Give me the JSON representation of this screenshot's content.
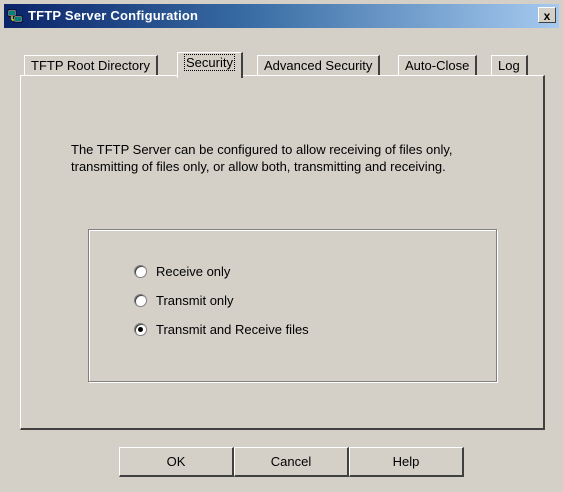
{
  "window": {
    "title": "TFTP Server Configuration",
    "close_label": "x"
  },
  "tabs": [
    {
      "label": "TFTP Root Directory",
      "active": false
    },
    {
      "label": "Security",
      "active": true
    },
    {
      "label": "Advanced Security",
      "active": false
    },
    {
      "label": "Auto-Close",
      "active": false
    },
    {
      "label": "Log",
      "active": false
    }
  ],
  "security": {
    "description": "The TFTP Server can be configured to allow receiving of files only, transmitting of files only, or allow both, transmitting and receiving.",
    "options": [
      {
        "label": "Receive only",
        "checked": false
      },
      {
        "label": "Transmit only",
        "checked": false
      },
      {
        "label": "Transmit and Receive files",
        "checked": true
      }
    ]
  },
  "buttons": {
    "ok": "OK",
    "cancel": "Cancel",
    "help": "Help"
  },
  "colors": {
    "face": "#d4d0c8",
    "title_start": "#0a246a",
    "title_end": "#a6caf0"
  }
}
